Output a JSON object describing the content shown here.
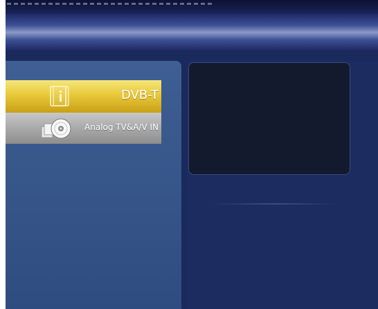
{
  "menu": {
    "items": [
      {
        "label": "DVB-T",
        "icon": "info-icon",
        "selected": true
      },
      {
        "label": "Analog TV&A/V IN",
        "icon": "disc-icon",
        "selected": false
      }
    ]
  },
  "colors": {
    "screen_background": "#1a2a5c",
    "panel": "#3e5f93",
    "selected_item": "#e8c93a",
    "unselected_item": "#a9a9a9",
    "preview_window": "#141a2e"
  }
}
